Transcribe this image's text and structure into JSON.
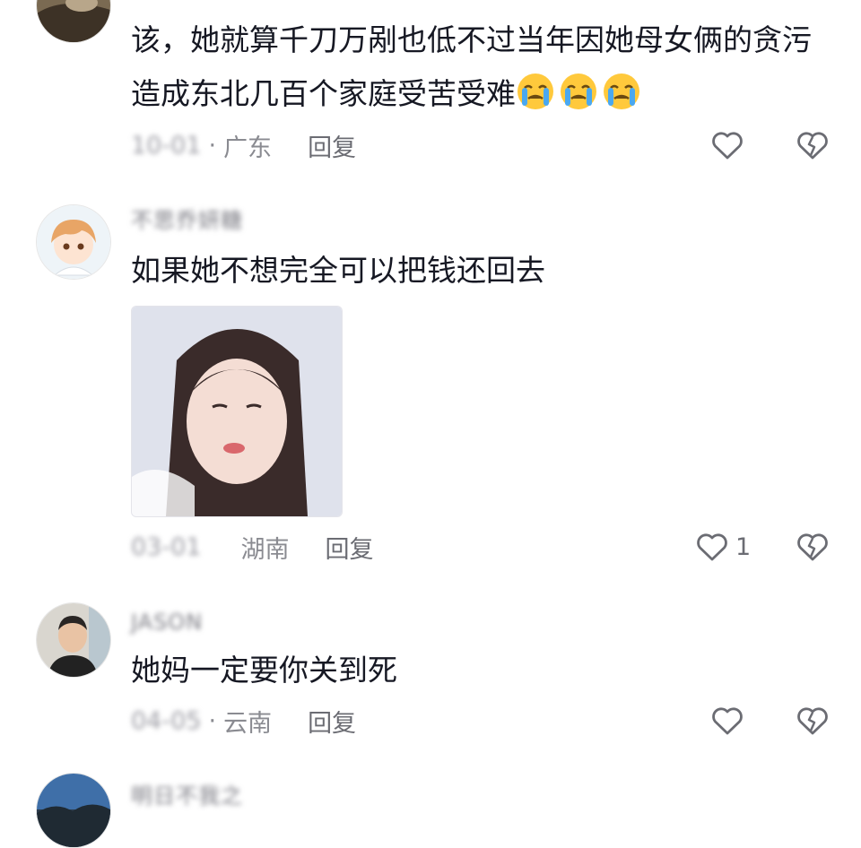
{
  "comments": [
    {
      "username": "",
      "text": "该，她就算千刀万剐也低不过当年因她母女俩的贪污造成东北几百个家庭受苦受难",
      "emoji": [
        "loudly-crying-face",
        "loudly-crying-face",
        "loudly-crying-face"
      ],
      "time": "10-01",
      "dot": "·",
      "location": "广东",
      "reply": "回复",
      "likes": ""
    },
    {
      "username": "不思乔妍糖",
      "text": "如果她不想完全可以把钱还回去",
      "sticker": "girl-sticker-image",
      "time": "03-01",
      "location": "湖南",
      "reply": "回复",
      "likes": "1"
    },
    {
      "username": "JASON",
      "text": "她妈一定要你关到死",
      "time": "04-05",
      "dot": "·",
      "location": "云南",
      "reply": "回复",
      "likes": ""
    },
    {
      "username": "明日不我之",
      "text": ""
    }
  ],
  "icons": {
    "like": "heart-outline-icon",
    "dislike": "broken-heart-icon"
  },
  "colors": {
    "text": "#161823",
    "meta": "#8a8b91",
    "icon": "#6b6c73"
  }
}
